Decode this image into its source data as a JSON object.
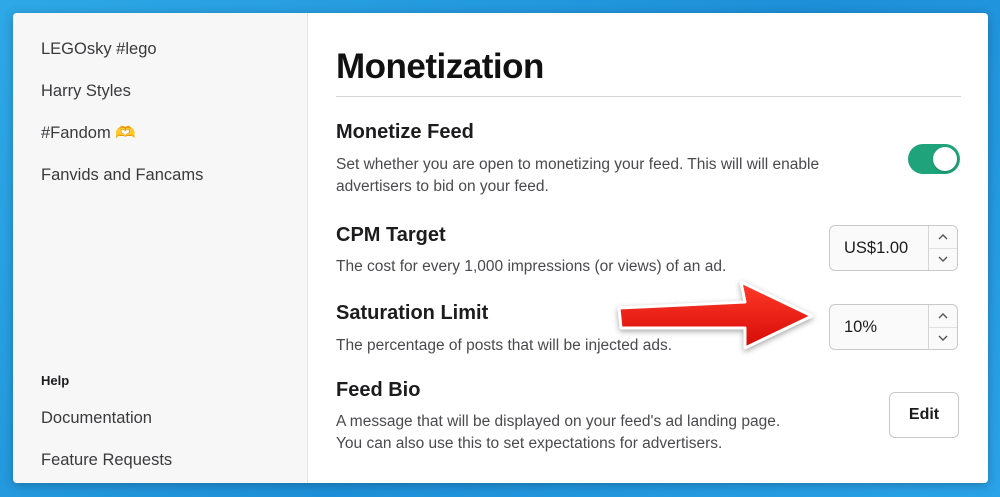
{
  "sidebar": {
    "items": [
      {
        "label": "LEGOsky #lego"
      },
      {
        "label": "Harry Styles"
      },
      {
        "label": "#Fandom 🫶"
      },
      {
        "label": "Fanvids and Fancams"
      }
    ],
    "help": {
      "heading": "Help",
      "items": [
        {
          "label": "Documentation"
        },
        {
          "label": "Feature Requests"
        }
      ]
    }
  },
  "main": {
    "title": "Monetization",
    "monetize_feed": {
      "title": "Monetize Feed",
      "description": "Set whether you are open to monetizing your feed. This will will enable advertisers to bid on your feed.",
      "enabled": true
    },
    "cpm_target": {
      "title": "CPM Target",
      "description": "The cost for every 1,000 impressions (or views) of an ad.",
      "value": "US$1.00"
    },
    "saturation_limit": {
      "title": "Saturation Limit",
      "description": "The percentage of posts that will be injected ads.",
      "value": "10%"
    },
    "feed_bio": {
      "title": "Feed Bio",
      "description_line1": "A message that will be displayed on your feed's ad landing page.",
      "description_line2": "You can also use this to set expectations for advertisers.",
      "edit_label": "Edit"
    }
  },
  "colors": {
    "accent_toggle": "#1fa37a",
    "annotation_arrow": "#e8120c",
    "background": "#1d8fd8"
  },
  "icons": {
    "stepper_up": "chevron-up-icon",
    "stepper_down": "chevron-down-icon",
    "annotation": "red-arrow-annotation"
  }
}
